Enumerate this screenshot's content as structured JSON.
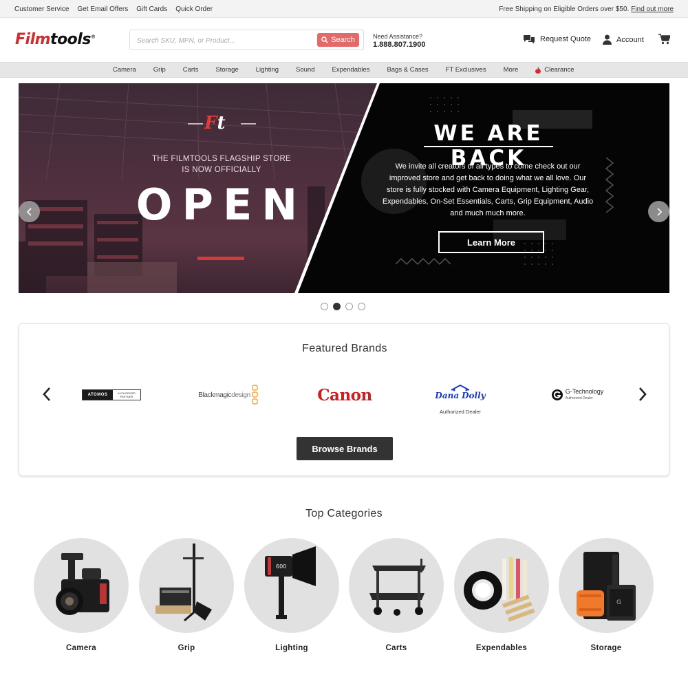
{
  "topbar": {
    "links": [
      "Customer Service",
      "Get Email Offers",
      "Gift Cards",
      "Quick Order"
    ],
    "promo": "Free Shipping on Eligible Orders over $50.",
    "promo_link": "Find out more"
  },
  "header": {
    "logo_red": "Film",
    "logo_black": "tools",
    "search_placeholder": "Search SKU, MPN, or Product...",
    "search_button": "Search",
    "assist_label": "Need Assistance?",
    "assist_phone": "1.888.807.1900",
    "quote_label": "Request Quote",
    "account_label": "Account"
  },
  "nav": {
    "items": [
      "Camera",
      "Grip",
      "Carts",
      "Storage",
      "Lighting",
      "Sound",
      "Expendables",
      "Bags & Cases",
      "FT Exclusives",
      "More"
    ],
    "clearance": "Clearance"
  },
  "hero": {
    "logo_f": "F",
    "logo_t": "t",
    "flagship_line1": "THE FILMTOOLS FLAGSHIP STORE",
    "flagship_line2": "IS NOW OFFICIALLY",
    "open": "OPEN",
    "headline": "WE ARE BACK",
    "copy": "We invite all creators of all types to come check out our improved store and get back to doing what we all love. Our store is fully stocked with Camera Equipment, Lighting Gear, Expendables, On-Set Essentials, Carts, Grip Equipment, Audio and much much  more.",
    "cta": "Learn More",
    "slide_count": 4,
    "active_slide": 2
  },
  "brands": {
    "title": "Featured Brands",
    "atomos_text": "ATOMOS",
    "atomos_tag": "AUTHORIZED PARTNER",
    "blackmagic_a": "Blackmagic",
    "blackmagic_b": "design",
    "canon": "Canon",
    "dana_line1": "Dana",
    "dana_line2": "Dolly",
    "dana_sub": "Authorized Dealer",
    "gtech": "G-Technology",
    "gtech_sub": "Authorized Dealer",
    "browse_button": "Browse Brands",
    "colors": {
      "canon_red": "#cc1f1f",
      "dana_blue": "#1a3cc4",
      "blackmagic_orange": "#f0a53a"
    }
  },
  "categories": {
    "title": "Top Categories",
    "items": [
      {
        "label": "Camera",
        "icon": "camera-icon"
      },
      {
        "label": "Grip",
        "icon": "grip-stand-icon"
      },
      {
        "label": "Lighting",
        "icon": "light-icon"
      },
      {
        "label": "Carts",
        "icon": "cart-icon"
      },
      {
        "label": "Expendables",
        "icon": "tape-icon"
      },
      {
        "label": "Storage",
        "icon": "storage-drive-icon"
      }
    ]
  },
  "colors": {
    "accent_red": "#d12d2d",
    "search_button": "#e46a6a",
    "dark_button": "#333333"
  }
}
